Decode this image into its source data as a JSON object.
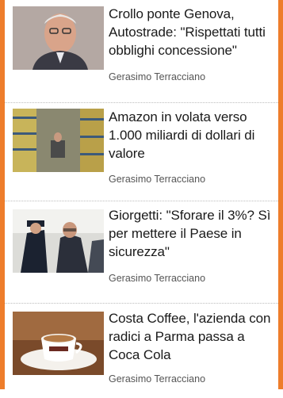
{
  "articles": [
    {
      "title": "Crollo ponte Genova, Autostrade: \"Rispettati tutti obblighi concessione\"",
      "author": "Gerasimo Terracciano",
      "thumbnail": "elderly-man-portrait-image"
    },
    {
      "title": "Amazon in volata verso 1.000 miliardi di dollari di valore",
      "author": "Gerasimo Terracciano",
      "thumbnail": "warehouse-shelves-image"
    },
    {
      "title": "Giorgetti: \"Sforare il 3%? Sì per mettere il Paese in sicurezza\"",
      "author": "Gerasimo Terracciano",
      "thumbnail": "politician-with-guard-image"
    },
    {
      "title": "Costa Coffee, l'azienda con radici a Parma passa a Coca Cola",
      "author": "Gerasimo Terracciano",
      "thumbnail": "coffee-cup-image"
    }
  ],
  "colors": {
    "frame": "#ee7d2b",
    "separator": "#bdbdbd",
    "title": "#1a1a1a",
    "author": "#555555"
  }
}
